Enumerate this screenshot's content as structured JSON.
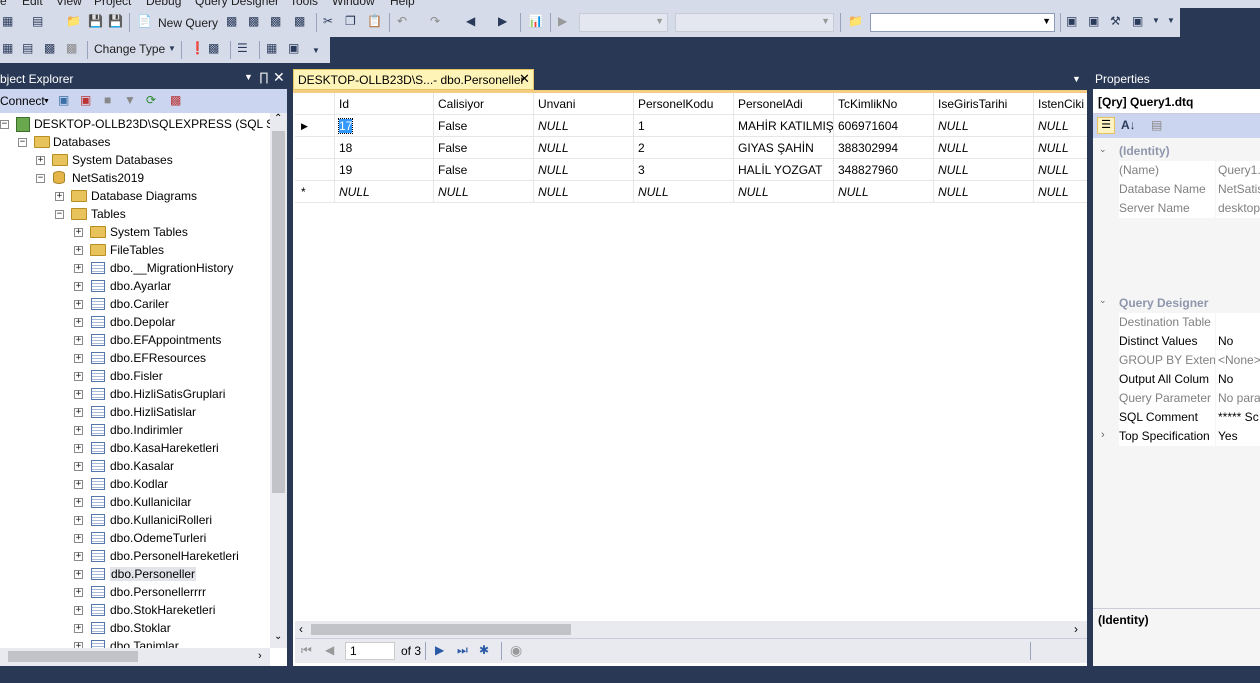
{
  "menu": [
    "e",
    "Edit",
    "View",
    "Project",
    "Debug",
    "Query Designer",
    "Tools",
    "Window",
    "Help"
  ],
  "toolbar": {
    "new_query": "New Query",
    "change_type": "Change Type"
  },
  "object_explorer": {
    "title": "bject Explorer",
    "connect": "Connect",
    "server": "DESKTOP-OLLB23D\\SQLEXPRESS (SQL Server",
    "databases": "Databases",
    "system_databases": "System Databases",
    "database": "NetSatis2019",
    "database_diagrams": "Database Diagrams",
    "tables": "Tables",
    "system_tables": "System Tables",
    "file_tables": "FileTables",
    "table_items": [
      "dbo.__MigrationHistory",
      "dbo.Ayarlar",
      "dbo.Cariler",
      "dbo.Depolar",
      "dbo.EFAppointments",
      "dbo.EFResources",
      "dbo.Fisler",
      "dbo.HizliSatisGruplari",
      "dbo.HizliSatislar",
      "dbo.Indirimler",
      "dbo.KasaHareketleri",
      "dbo.Kasalar",
      "dbo.Kodlar",
      "dbo.Kullanicilar",
      "dbo.KullaniciRolleri",
      "dbo.OdemeTurleri",
      "dbo.PersonelHareketleri",
      "dbo.Personeller",
      "dbo.Personellerrrr",
      "dbo.StokHareketleri",
      "dbo.Stoklar",
      "dbo.Tanimlar"
    ],
    "selected_item": "dbo.Personeller"
  },
  "document": {
    "tab_title": "DESKTOP-OLLB23D\\S...- dbo.Personeller",
    "columns": [
      "Id",
      "Calisiyor",
      "Unvani",
      "PersonelKodu",
      "PersonelAdi",
      "TcKimlikNo",
      "IseGirisTarihi",
      "IstenCiki"
    ],
    "rows": [
      [
        "17",
        "False",
        "NULL",
        "1",
        "MAHİR KATILMIŞ",
        "606971604",
        "NULL",
        "NULL"
      ],
      [
        "18",
        "False",
        "NULL",
        "2",
        "GIYAS ŞAHİN",
        "388302994",
        "NULL",
        "NULL"
      ],
      [
        "19",
        "False",
        "NULL",
        "3",
        "HALİL YOZGAT",
        "348827960",
        "NULL",
        "NULL"
      ],
      [
        "NULL",
        "NULL",
        "NULL",
        "NULL",
        "NULL",
        "NULL",
        "NULL",
        "NULL"
      ]
    ],
    "nav": {
      "page": "1",
      "of": "of 3"
    }
  },
  "properties": {
    "title": "Properties",
    "object": "[Qry] Query1.dtq",
    "cat_identity": "(Identity)",
    "cat_query_designer": "Query Designer",
    "rows": [
      {
        "name": "(Name)",
        "value": "Query1.",
        "gray": true
      },
      {
        "name": "Database Name",
        "value": "NetSatis",
        "gray": true
      },
      {
        "name": "Server Name",
        "value": "desktop",
        "gray": true
      },
      {
        "name": "Destination Table",
        "value": "",
        "gray": true
      },
      {
        "name": "Distinct Values",
        "value": "No",
        "gray": false
      },
      {
        "name": "GROUP BY Extensi",
        "value": "<None>",
        "gray": true
      },
      {
        "name": "Output All Colum",
        "value": "No",
        "gray": false
      },
      {
        "name": "Query Parameter L",
        "value": "No para",
        "gray": true
      },
      {
        "name": "SQL Comment",
        "value": "***** Sc",
        "gray": false
      },
      {
        "name": "Top Specification",
        "value": "Yes",
        "gray": false
      }
    ],
    "description_title": "(Identity)"
  },
  "colors": {
    "frame": "#293955",
    "toolbar": "#d6dbe9",
    "tab_active": "#fff4b8",
    "accent": "#f5cc84"
  }
}
